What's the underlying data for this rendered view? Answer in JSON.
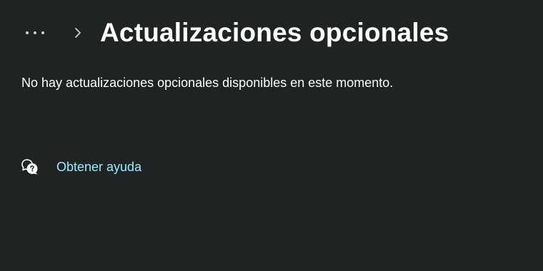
{
  "header": {
    "title": "Actualizaciones opcionales",
    "more_icon": "more-horizontal-icon",
    "separator_icon": "chevron-right-icon"
  },
  "main": {
    "message": "No hay actualizaciones opcionales disponibles en este momento."
  },
  "help": {
    "label": "Obtener ayuda",
    "icon": "help-chat-icon"
  },
  "colors": {
    "background": "#1f2323",
    "text": "#ffffff",
    "link": "#99ebff"
  }
}
